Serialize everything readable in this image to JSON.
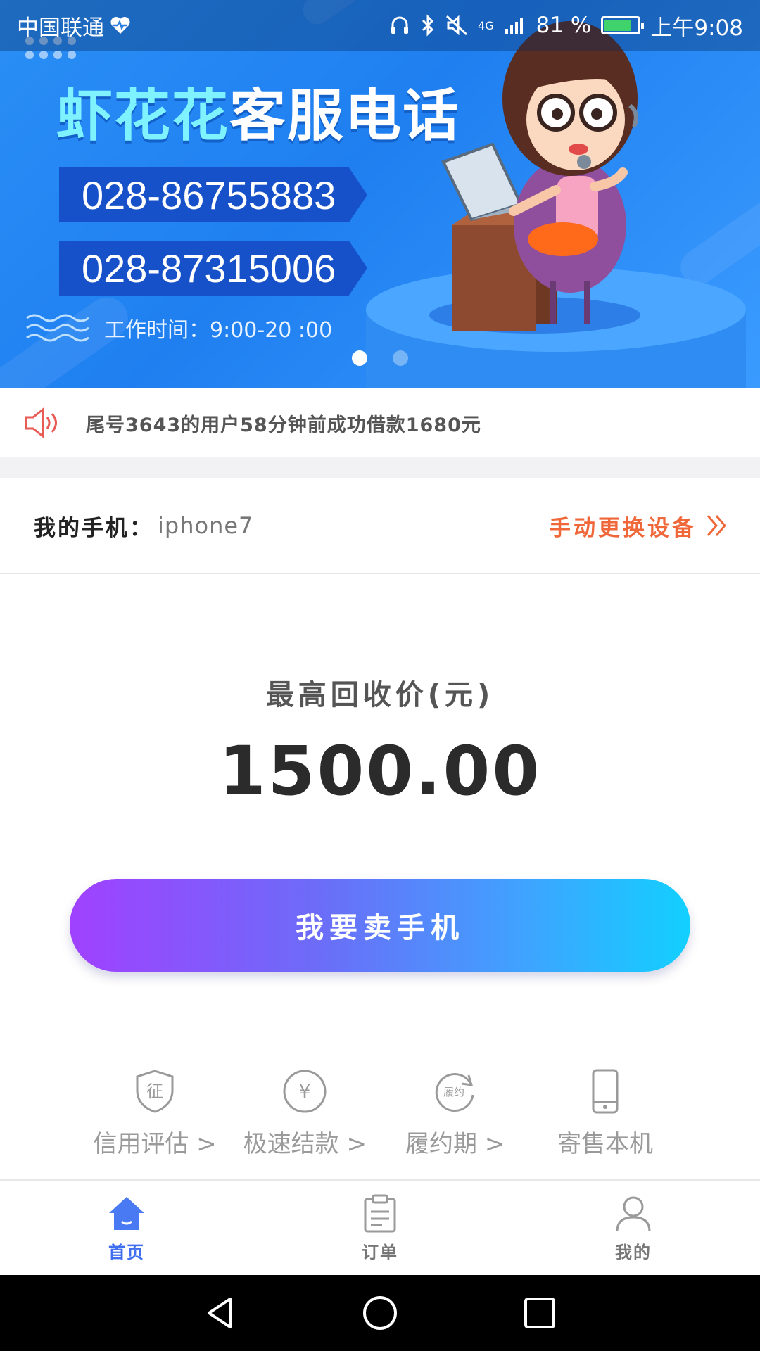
{
  "status_bar": {
    "carrier": "中国联通",
    "network": "4G",
    "battery": "81 %",
    "time": "上午9:08"
  },
  "banner": {
    "title_part1": "虾花花",
    "title_part2": "客服电话",
    "phones": [
      "028-86755883",
      "028-87315006"
    ],
    "hours": "工作时间：9:00-20 :00",
    "slides": 2,
    "active_slide": 0
  },
  "notice": {
    "text": "尾号3643的用户58分钟前成功借款1680元"
  },
  "my_phone": {
    "label": "我的手机：",
    "value": "iphone7",
    "change_label": "手动更换设备"
  },
  "price": {
    "label": "最高回收价(元)",
    "value": "1500.00"
  },
  "sell_button": {
    "label": "我要卖手机"
  },
  "features": [
    {
      "label": "信用评估  >",
      "icon": "shield-icon",
      "icon_text": "征"
    },
    {
      "label": "极速结款  >",
      "icon": "yuan-icon",
      "icon_text": "¥"
    },
    {
      "label": "履约期  >",
      "icon": "refresh-contract-icon",
      "icon_text": "履约"
    },
    {
      "label": "寄售本机",
      "icon": "phone-icon"
    }
  ],
  "tabs": [
    {
      "label": "首页",
      "icon": "home-icon",
      "active": true
    },
    {
      "label": "订单",
      "icon": "clipboard-icon",
      "active": false
    },
    {
      "label": "我的",
      "icon": "user-icon",
      "active": false
    }
  ],
  "colors": {
    "accent": "#3f6ff0",
    "banner_blue": "#1f7ff0",
    "change_orange": "#f0673a",
    "gradient_start": "#a041ff",
    "gradient_end": "#12d0ff"
  }
}
